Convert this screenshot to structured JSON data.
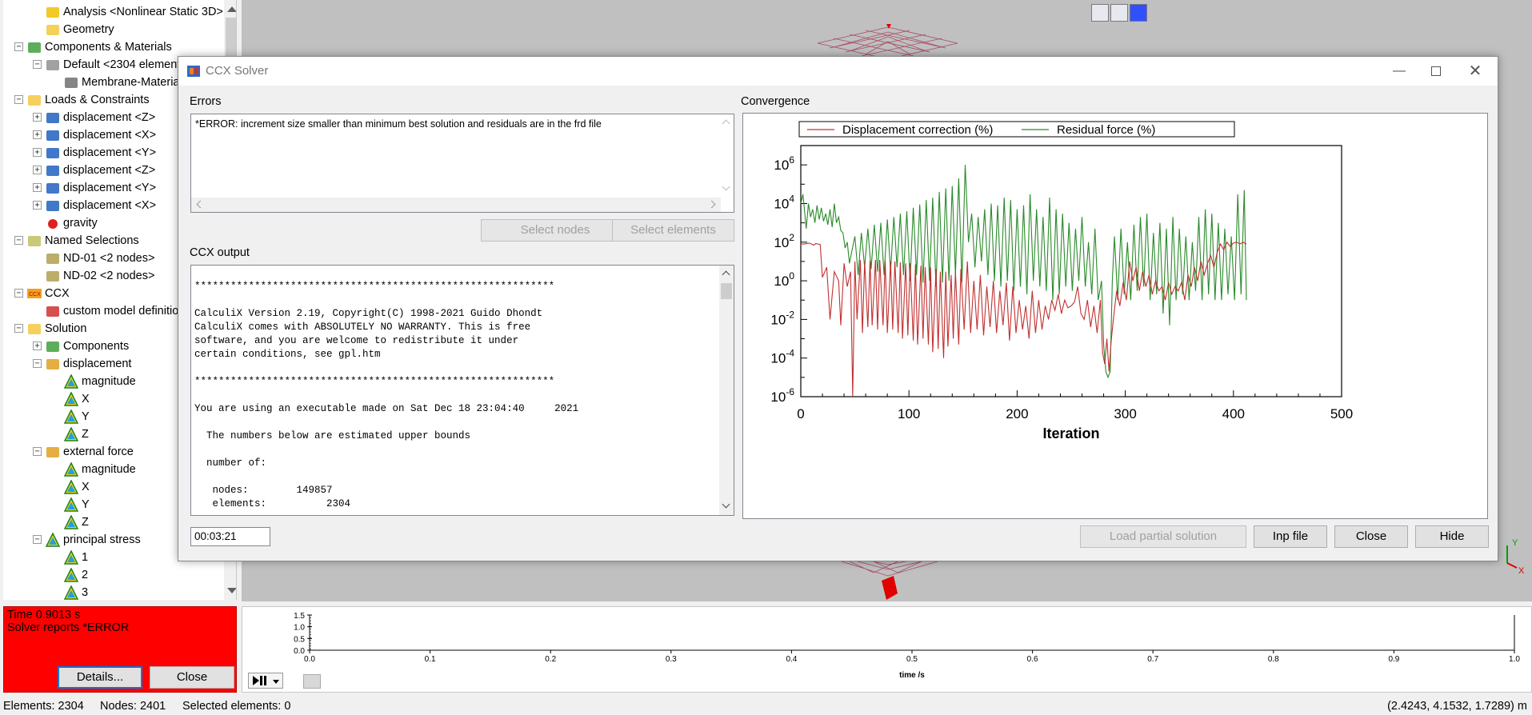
{
  "tree": {
    "items": [
      {
        "label": "Analysis <Nonlinear Static 3D>",
        "icon": "lightning-icon",
        "indent": 1,
        "toggle": ""
      },
      {
        "label": "Geometry",
        "icon": "folder-icon",
        "indent": 1,
        "toggle": ""
      },
      {
        "label": "Components & Materials",
        "icon": "components-icon",
        "indent": 0,
        "toggle": "−"
      },
      {
        "label": "Default <2304 elements>",
        "icon": "part-icon",
        "indent": 1,
        "toggle": "−"
      },
      {
        "label": "Membrane-Material",
        "icon": "material-icon",
        "indent": 2,
        "toggle": ""
      },
      {
        "label": "Loads & Constraints",
        "icon": "loads-folder-icon",
        "indent": 0,
        "toggle": "−"
      },
      {
        "label": "displacement <Z>",
        "icon": "displacement-bc-icon",
        "indent": 1,
        "toggle": "+"
      },
      {
        "label": "displacement <X>",
        "icon": "displacement-bc-icon",
        "indent": 1,
        "toggle": "+"
      },
      {
        "label": "displacement <Y>",
        "icon": "displacement-bc-icon",
        "indent": 1,
        "toggle": "+"
      },
      {
        "label": "displacement <Z>",
        "icon": "displacement-bc-icon",
        "indent": 1,
        "toggle": "+"
      },
      {
        "label": "displacement <Y>",
        "icon": "displacement-bc-icon",
        "indent": 1,
        "toggle": "+"
      },
      {
        "label": "displacement <X>",
        "icon": "displacement-bc-icon",
        "indent": 1,
        "toggle": "+"
      },
      {
        "label": "gravity",
        "icon": "gravity-icon",
        "indent": 1,
        "toggle": ""
      },
      {
        "label": "Named Selections",
        "icon": "named-selections-icon",
        "indent": 0,
        "toggle": "−"
      },
      {
        "label": "ND-01 <2 nodes>",
        "icon": "node-set-icon",
        "indent": 1,
        "toggle": ""
      },
      {
        "label": "ND-02 <2 nodes>",
        "icon": "node-set-icon",
        "indent": 1,
        "toggle": ""
      },
      {
        "label": "CCX",
        "icon": "ccx-icon",
        "indent": 0,
        "toggle": "−"
      },
      {
        "label": "custom model definition",
        "icon": "custom-model-icon",
        "indent": 1,
        "toggle": ""
      },
      {
        "label": "Solution",
        "icon": "solution-icon",
        "indent": 0,
        "toggle": "−"
      },
      {
        "label": "Components",
        "icon": "components-icon",
        "indent": 1,
        "toggle": "+"
      },
      {
        "label": "displacement",
        "icon": "result-group-icon",
        "indent": 1,
        "toggle": "−"
      },
      {
        "label": "magnitude",
        "icon": "contour-icon",
        "indent": 2,
        "toggle": ""
      },
      {
        "label": "X",
        "icon": "contour-icon",
        "indent": 2,
        "toggle": ""
      },
      {
        "label": "Y",
        "icon": "contour-icon",
        "indent": 2,
        "toggle": ""
      },
      {
        "label": "Z",
        "icon": "contour-icon",
        "indent": 2,
        "toggle": ""
      },
      {
        "label": "external force",
        "icon": "result-group-icon",
        "indent": 1,
        "toggle": "−"
      },
      {
        "label": "magnitude",
        "icon": "contour-icon",
        "indent": 2,
        "toggle": ""
      },
      {
        "label": "X",
        "icon": "contour-icon",
        "indent": 2,
        "toggle": ""
      },
      {
        "label": "Y",
        "icon": "contour-icon",
        "indent": 2,
        "toggle": ""
      },
      {
        "label": "Z",
        "icon": "contour-icon",
        "indent": 2,
        "toggle": ""
      },
      {
        "label": "principal stress",
        "icon": "contour-icon",
        "indent": 1,
        "toggle": "−"
      },
      {
        "label": "1",
        "icon": "contour-icon",
        "indent": 2,
        "toggle": ""
      },
      {
        "label": "2",
        "icon": "contour-icon",
        "indent": 2,
        "toggle": ""
      },
      {
        "label": "3",
        "icon": "contour-icon",
        "indent": 2,
        "toggle": ""
      }
    ]
  },
  "error_panel": {
    "line1": "Time 0.9013 s",
    "line2": "Solver reports *ERROR",
    "details_label": "Details...",
    "close_label": "Close",
    "background": "#ff0000"
  },
  "timeline": {
    "y_ticks": [
      "1.5",
      "1.0",
      "0.5",
      "0.0"
    ],
    "x_ticks": [
      "0.0",
      "0.1",
      "0.2",
      "0.3",
      "0.4",
      "0.5",
      "0.6",
      "0.7",
      "0.8",
      "0.9",
      "1.0"
    ],
    "xlabel": "time /s",
    "play_pause_icon": "play-pause-icon"
  },
  "status": {
    "elements": "Elements: 2304",
    "nodes": "Nodes: 2401",
    "selected": "Selected elements: 0",
    "coords": "(2.4243, 4.1532, 1.7289) m"
  },
  "dialog": {
    "title": "CCX Solver",
    "errors_label": "Errors",
    "errors_text": "*ERROR: increment size smaller than minimum best solution and residuals are in the frd file",
    "select_nodes": "Select nodes",
    "select_elements": "Select elements",
    "ccx_output_label": "CCX output",
    "ccx_output": "************************************************************\n\nCalculiX Version 2.19, Copyright(C) 1998-2021 Guido Dhondt\nCalculiX comes with ABSOLUTELY NO WARRANTY. This is free\nsoftware, and you are welcome to redistribute it under\ncertain conditions, see gpl.htm\n\n************************************************************\n\nYou are using an executable made on Sat Dec 18 23:04:40     2021\n\n  The numbers below are estimated upper bounds\n\n  number of:\n\n   nodes:        149857\n   elements:          2304",
    "timer": "00:03:21",
    "convergence_label": "Convergence",
    "load_partial": "Load partial solution",
    "inp_file": "Inp file",
    "close": "Close",
    "hide": "Hide"
  },
  "chart_data": {
    "type": "line",
    "title": "",
    "xlabel": "Iteration",
    "ylabel": "",
    "xlim": [
      0,
      500
    ],
    "x_ticks": [
      0,
      100,
      200,
      300,
      400,
      500
    ],
    "y_scale": "log",
    "ylim": [
      1e-06,
      10000000.0
    ],
    "y_ticks": [
      "10^6",
      "10^4",
      "10^2",
      "10^0",
      "10^-2",
      "10^-4",
      "10^-6"
    ],
    "legend_position": "top",
    "series": [
      {
        "name": "Displacement correction (%)",
        "color": "#c03030",
        "x": [
          0,
          3,
          8,
          12,
          14,
          18,
          20,
          24,
          27,
          31,
          35,
          37,
          40,
          43,
          46,
          48,
          50,
          52,
          55,
          57,
          59,
          62,
          64,
          66,
          69,
          71,
          73,
          76,
          78,
          80,
          83,
          85,
          87,
          90,
          92,
          94,
          97,
          99,
          101,
          104,
          106,
          108,
          111,
          113,
          115,
          118,
          120,
          122,
          125,
          127,
          129,
          132,
          134,
          136,
          139,
          141,
          143,
          146,
          148,
          151,
          154,
          157,
          160,
          163,
          166,
          169,
          172,
          175,
          178,
          181,
          184,
          187,
          190,
          193,
          196,
          199,
          202,
          205,
          208,
          211,
          214,
          217,
          220,
          223,
          226,
          229,
          232,
          235,
          238,
          241,
          244,
          247,
          250,
          253,
          256,
          259,
          262,
          265,
          268,
          271,
          274,
          277,
          279,
          281,
          283,
          285,
          287,
          289,
          292,
          295,
          298,
          301,
          304,
          307,
          310,
          313,
          316,
          319,
          322,
          325,
          328,
          331,
          334,
          337,
          340,
          343,
          346,
          349,
          352,
          355,
          358,
          361,
          364,
          367,
          370,
          373,
          376,
          379,
          382,
          385,
          388,
          391,
          394,
          397,
          400,
          403,
          406,
          409,
          412
        ],
        "y": [
          80,
          80,
          90,
          70,
          85,
          75,
          1.5,
          5,
          0.01,
          3,
          1,
          0.005,
          8,
          0.5,
          3,
          5e-08,
          10,
          0.01,
          12,
          0.002,
          10,
          0.004,
          11,
          0.005,
          12,
          0.003,
          12,
          0.005,
          11,
          0.002,
          10,
          0.003,
          10,
          0.002,
          9,
          0.001,
          8,
          0.0015,
          8,
          0.0008,
          7,
          0.0005,
          6,
          0.001,
          5,
          0.0005,
          5,
          0.0002,
          4,
          0.0003,
          3,
          0.0001,
          3,
          0.0004,
          2,
          0.001,
          3,
          0.0005,
          4,
          0.003,
          10,
          0.002,
          1,
          0.003,
          2,
          0.0015,
          0.5,
          0.004,
          1,
          0.002,
          0.3,
          0.005,
          0.8,
          0.0008,
          0.5,
          0.002,
          0.1,
          0.003,
          0.05,
          0.001,
          0.3,
          0.002,
          0.1,
          0.003,
          0.05,
          0.01,
          0.1,
          0.03,
          0.2,
          0.02,
          0.1,
          0.04,
          0.05,
          0.08,
          0.5,
          0.02,
          0.01,
          0.1,
          0.004,
          0.05,
          0.002,
          0.1,
          0.0002,
          5e-05,
          0.001,
          2e-05,
          0.0008,
          0.01,
          0.3,
          0.05,
          0.8,
          0.1,
          10,
          1,
          5,
          0.3,
          3,
          0.5,
          2,
          0.2,
          1,
          0.3,
          0.5,
          0.1,
          0.8,
          0.2,
          0.5,
          0.3,
          0.8,
          0.1,
          2,
          0.5,
          5,
          1,
          10,
          2,
          8,
          20,
          5,
          30,
          80,
          40,
          100,
          60,
          90,
          100,
          80,
          100,
          80
        ]
      },
      {
        "name": "Residual force (%)",
        "color": "#2a8a2a",
        "x": [
          0,
          2,
          5,
          7,
          9,
          11,
          13,
          15,
          17,
          19,
          21,
          23,
          25,
          27,
          29,
          31,
          33,
          35,
          37,
          39,
          41,
          43,
          45,
          47,
          50,
          53,
          56,
          59,
          62,
          65,
          68,
          71,
          74,
          77,
          80,
          83,
          86,
          89,
          92,
          95,
          98,
          101,
          104,
          107,
          110,
          113,
          116,
          119,
          122,
          125,
          128,
          131,
          134,
          137,
          140,
          143,
          146,
          149,
          152,
          155,
          158,
          161,
          164,
          167,
          170,
          173,
          176,
          179,
          182,
          185,
          188,
          191,
          194,
          197,
          200,
          203,
          206,
          209,
          212,
          215,
          218,
          221,
          224,
          227,
          230,
          233,
          236,
          239,
          242,
          245,
          248,
          251,
          254,
          257,
          260,
          263,
          266,
          269,
          272,
          275,
          278,
          280,
          282,
          284,
          286,
          288,
          290,
          293,
          296,
          299,
          302,
          305,
          308,
          311,
          314,
          317,
          320,
          323,
          326,
          329,
          332,
          335,
          338,
          341,
          344,
          347,
          350,
          353,
          356,
          359,
          362,
          365,
          368,
          371,
          374,
          377,
          380,
          383,
          386,
          389,
          392,
          395,
          398,
          401,
          404,
          407,
          410,
          412
        ],
        "y": [
          10000,
          30000,
          500,
          10000,
          2000,
          5000,
          1000,
          8000,
          1500,
          6000,
          1200,
          3000,
          800,
          5000,
          600,
          10000,
          1000,
          2000,
          400,
          300,
          50,
          100,
          8,
          30,
          200,
          2,
          300,
          5,
          500,
          4,
          800,
          3,
          1000,
          2,
          1500,
          3,
          2000,
          5,
          3000,
          2,
          4000,
          1,
          6000,
          2,
          9000,
          0.8,
          15000,
          1,
          20000,
          0.5,
          40000,
          0.8,
          60000,
          1,
          80000,
          2,
          200000,
          0.8,
          1000000,
          100,
          3000,
          5,
          2000,
          10,
          5000,
          2,
          10000,
          1,
          8000,
          0.5,
          20000,
          1,
          15000,
          0.3,
          5000,
          0.5,
          8000,
          0.2,
          30000,
          1,
          5000,
          0.5,
          2000,
          0.3,
          20000,
          0.1,
          5000,
          0.2,
          3000,
          0.5,
          1000,
          0.3,
          500,
          1,
          2000,
          0.5,
          100,
          0.2,
          500,
          0.1,
          1,
          0.0005,
          2e-05,
          1e-05,
          2e-05,
          1,
          200,
          0.1,
          500,
          0.2,
          100,
          0.1,
          800,
          0.3,
          2000,
          0.5,
          3000,
          0.1,
          300,
          0.2,
          1000,
          0.02,
          500,
          0.005,
          2000,
          0.1,
          500,
          0.2,
          200,
          0.1,
          100,
          0.3,
          2000,
          0.1,
          5000,
          0.2,
          3000,
          0.1,
          1000,
          0.1,
          500,
          0.2,
          200,
          0.1,
          30000,
          0.2,
          50000,
          0.1
        ]
      }
    ]
  }
}
